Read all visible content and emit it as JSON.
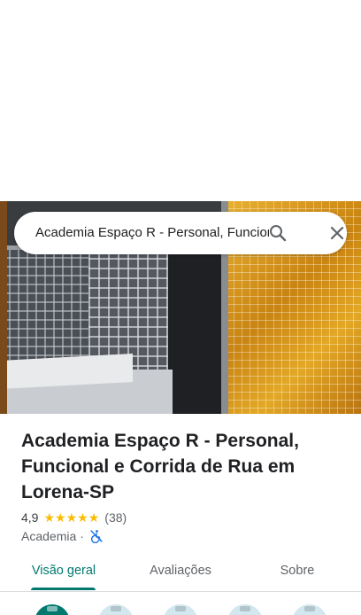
{
  "search": {
    "query": "Academia Espaço R - Personal, Funcional e Corrida de Rua em Lorena-SP",
    "search_icon": "search-icon",
    "close_icon": "close-icon"
  },
  "place": {
    "title": "Academia Espaço R - Personal, Funcional e Corrida de Rua em Lorena-SP",
    "rating": "4,9",
    "rating_stars": 5,
    "review_count": "(38)",
    "category": "Academia",
    "separator": "·",
    "accessibility_icon": "wheelchair-not-accessible-icon"
  },
  "tabs": [
    {
      "label": "Visão geral",
      "active": true
    },
    {
      "label": "Avaliações",
      "active": false
    },
    {
      "label": "Sobre",
      "active": false
    }
  ],
  "colors": {
    "accent": "#01796f",
    "star": "#fbbc04",
    "accessibility": "#1a73e8"
  }
}
